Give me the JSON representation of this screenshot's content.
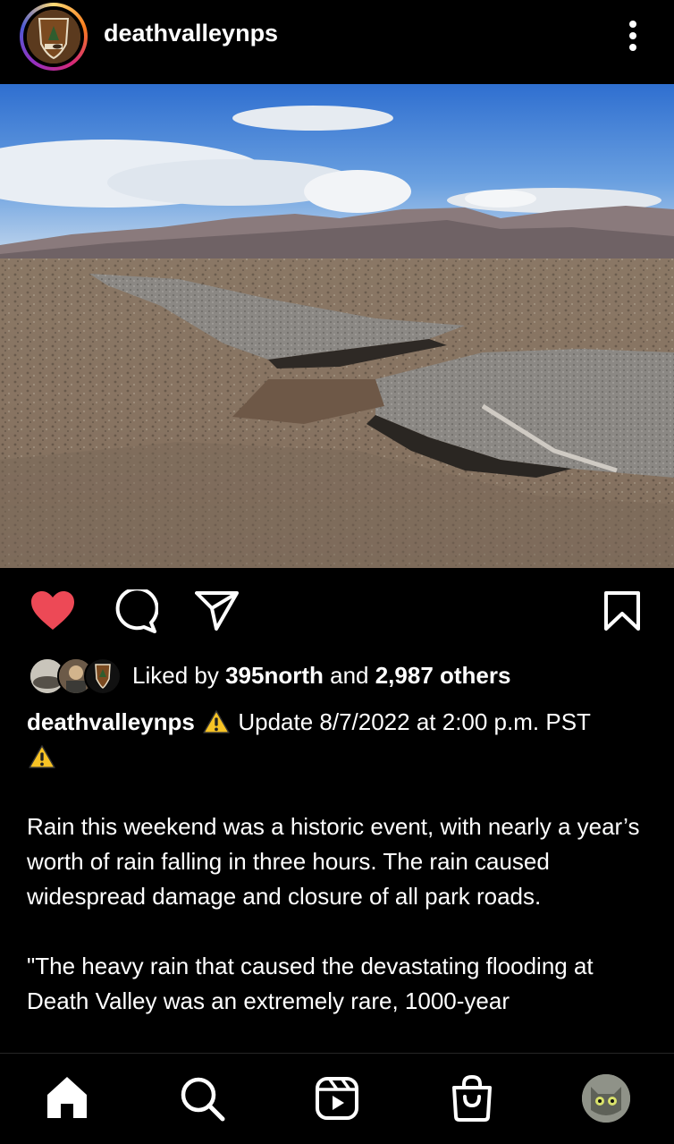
{
  "post": {
    "username": "deathvalleynps",
    "likes": {
      "prefix": "Liked by ",
      "first_user": "395north",
      "middle": " and ",
      "others": "2,987 others"
    },
    "caption": {
      "username": "deathvalleynps",
      "warning_icon": "warning-emoji",
      "update": "Update 8/7/2022 at 2:00 p.m. PST",
      "paragraph1": "Rain this weekend was a historic event, with nearly a year’s worth of rain falling in three hours. The rain caused widespread damage and closure of all park roads.",
      "paragraph2": "\"The heavy rain that caused the devastating flooding at Death Valley was an extremely rare, 1000-year"
    },
    "liked": true,
    "colors": {
      "like": "#ed4956",
      "background": "#000000",
      "text": "#ffffff"
    }
  },
  "icons": {
    "like": "heart-icon",
    "comment": "comment-icon",
    "share": "share-icon",
    "save": "bookmark-icon",
    "more": "more-vertical-icon"
  },
  "nav": {
    "items": [
      "home-icon",
      "search-icon",
      "reels-icon",
      "shop-icon",
      "profile-avatar"
    ]
  }
}
